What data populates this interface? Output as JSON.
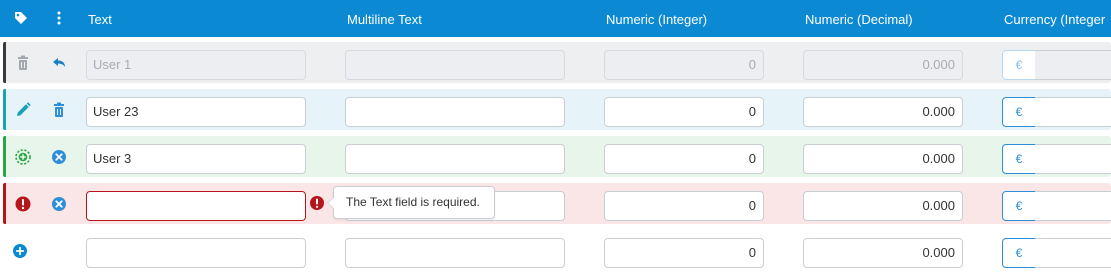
{
  "header": {
    "columns": {
      "text": "Text",
      "multiline": "Multiline Text",
      "numeric_integer": "Numeric (Integer)",
      "numeric_decimal": "Numeric (Decimal)",
      "currency_integer": "Currency (Integer"
    },
    "icons": {
      "tag": "tag-icon",
      "menu": "vertical-dots-icon"
    }
  },
  "colors": {
    "header_bg": "#0b8ad3",
    "row_disabled_bg": "#eeeff1",
    "row_edit_bg": "#e6f4fa",
    "row_new_bg": "#e8f5ea",
    "row_error_bg": "#fae6e6",
    "bar_disabled": "#3a3a3a",
    "bar_edit": "#17a2b8",
    "bar_new": "#28a745",
    "bar_error": "#b4161b",
    "accent_blue": "#0b8ad3",
    "error_red": "#b4161b"
  },
  "rows": [
    {
      "state": "deleted",
      "icons": [
        "trash-icon",
        "undo-icon"
      ],
      "text_placeholder": "User 1",
      "multiline_value": "",
      "int_value": "0",
      "decimal_value": "0.000",
      "currency_symbol": "€"
    },
    {
      "state": "edited",
      "icons": [
        "pencil-icon",
        "trash-icon"
      ],
      "text_value": "User 23",
      "multiline_value": "",
      "int_value": "0",
      "decimal_value": "0.000",
      "currency_symbol": "€"
    },
    {
      "state": "new",
      "icons": [
        "add-dashed-icon",
        "cancel-icon"
      ],
      "text_value": "User 3",
      "multiline_value": "",
      "int_value": "0",
      "decimal_value": "0.000",
      "currency_symbol": "€"
    },
    {
      "state": "error",
      "icons": [
        "error-icon",
        "cancel-icon"
      ],
      "text_value": "",
      "multiline_value": "",
      "int_value": "0",
      "decimal_value": "0.000",
      "currency_symbol": "€",
      "error_message": "The Text field is required."
    },
    {
      "state": "add",
      "icons": [
        "add-circle-icon"
      ],
      "text_value": "",
      "multiline_value": "",
      "int_value": "0",
      "decimal_value": "0.000",
      "currency_symbol": "€"
    }
  ]
}
